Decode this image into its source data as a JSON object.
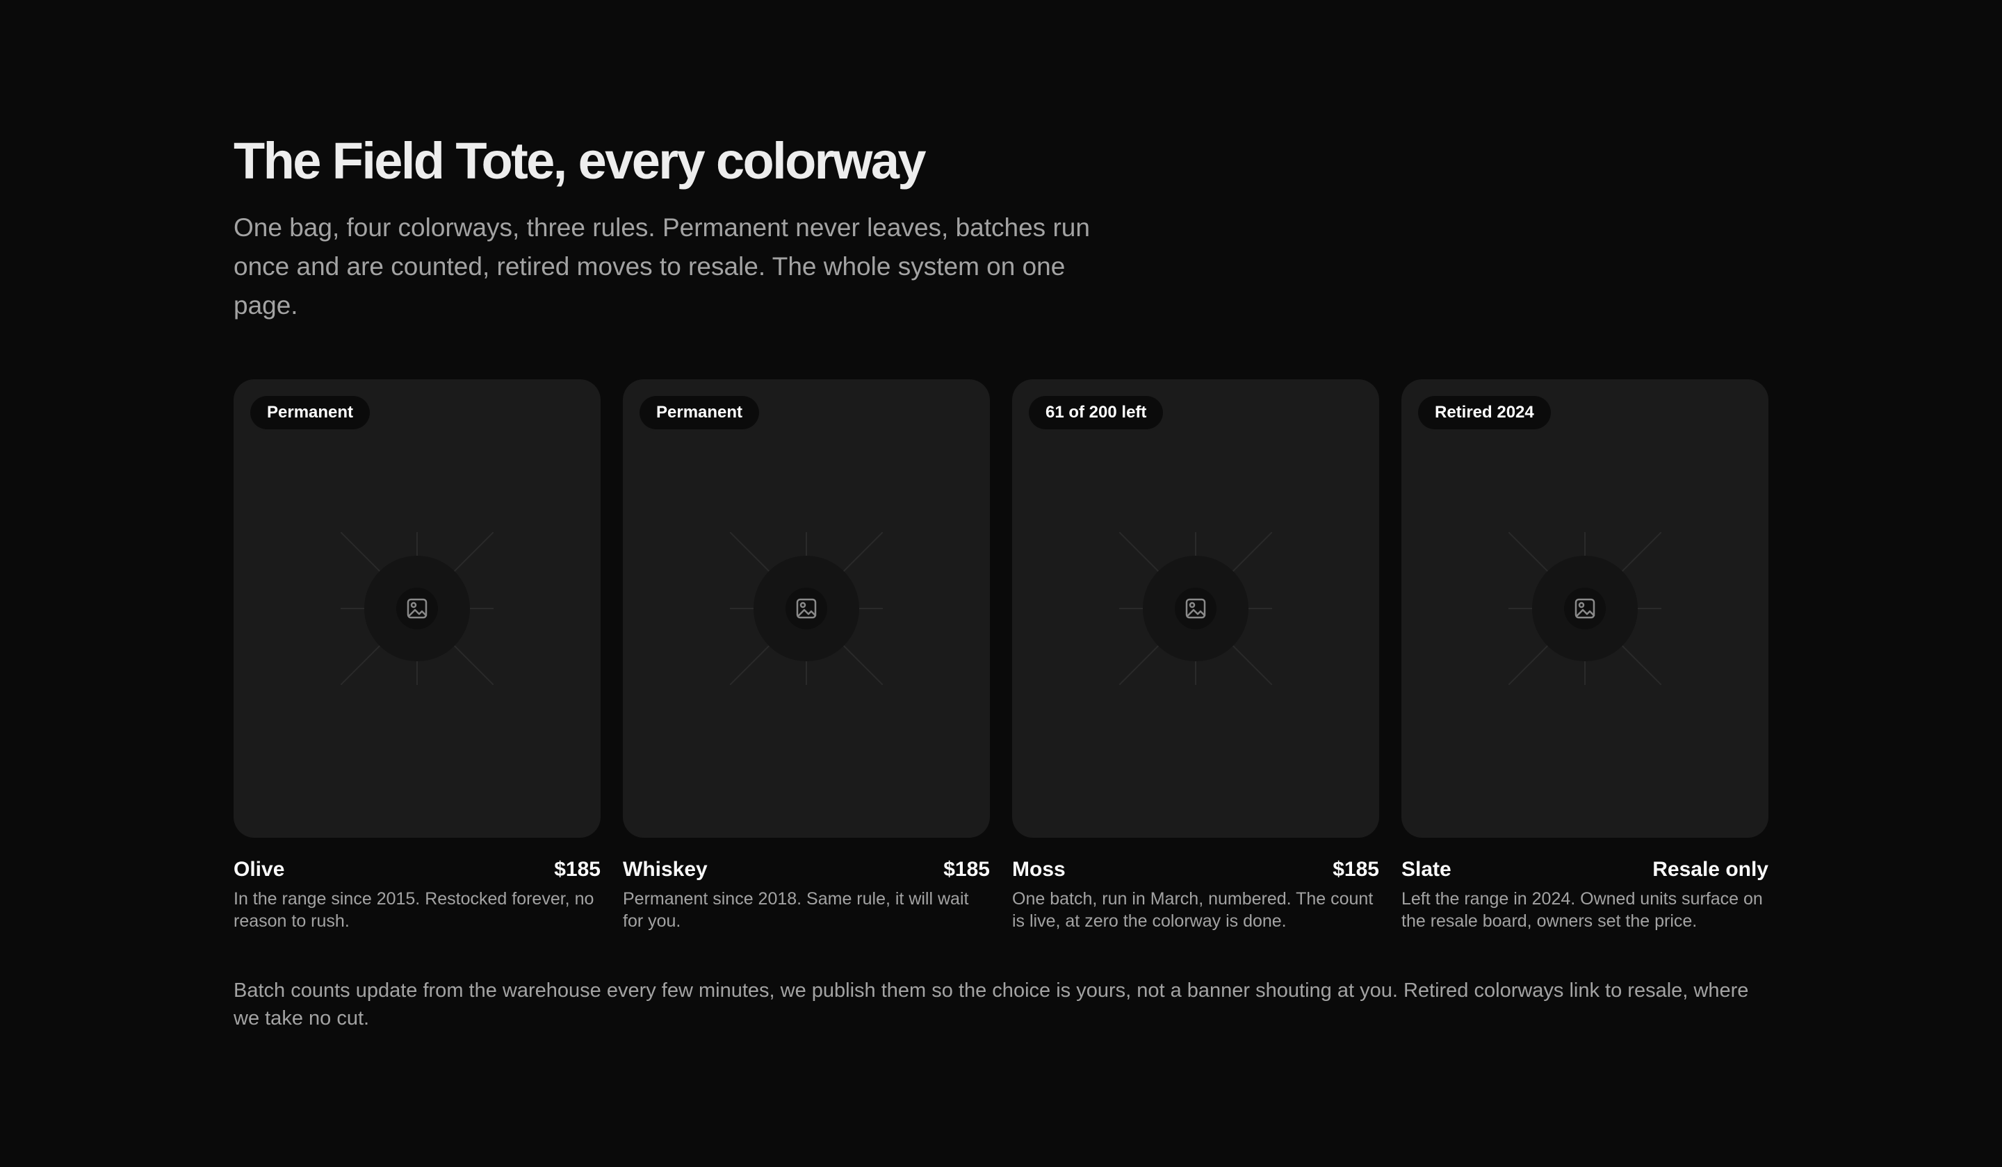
{
  "header": {
    "title": "The Field Tote, every colorway",
    "subtitle": "One bag, four colorways, three rules. Permanent never leaves, batches run once and are counted, retired moves to resale. The whole system on one page."
  },
  "cards": [
    {
      "badge": "Permanent",
      "name": "Olive",
      "price": "$185",
      "description": "In the range since 2015. Restocked forever, no reason to rush."
    },
    {
      "badge": "Permanent",
      "name": "Whiskey",
      "price": "$185",
      "description": "Permanent since 2018. Same rule, it will wait for you."
    },
    {
      "badge": "61 of 200 left",
      "name": "Moss",
      "price": "$185",
      "description": "One batch, run in March, numbered. The count is live, at zero the colorway is done."
    },
    {
      "badge": "Retired 2024",
      "name": "Slate",
      "price": "Resale only",
      "description": "Left the range in 2024. Owned units surface on the resale board, owners set the price."
    }
  ],
  "footer": {
    "note": "Batch counts update from the warehouse every few minutes, we publish them so the choice is yours, not a banner shouting at you. Retired colorways link to resale, where we take no cut."
  },
  "icons": {
    "placeholder": "image-placeholder-icon"
  },
  "colors": {
    "background": "#0a0a0a",
    "card": "#1b1b1b",
    "badge": "#0b0b0b",
    "text": "#fafafa",
    "muted": "#a3a3a3"
  }
}
